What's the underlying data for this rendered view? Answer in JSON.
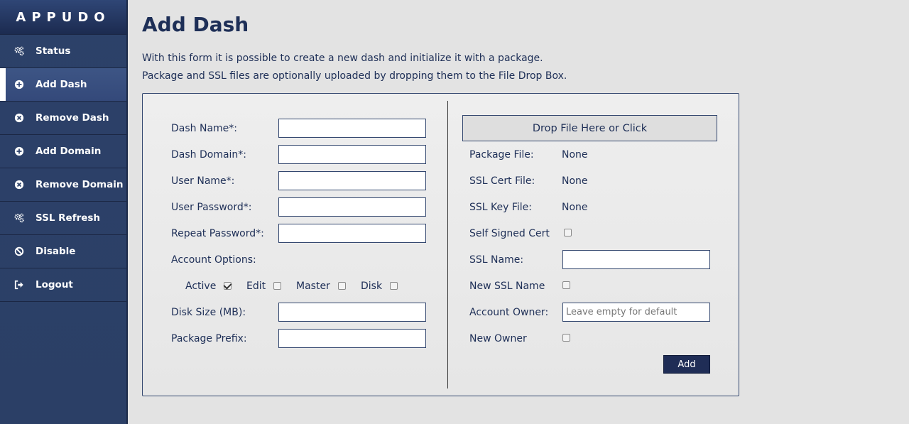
{
  "sidebar": {
    "logo": "APPUDO",
    "items": [
      {
        "label": "Status",
        "icon": "gears-icon"
      },
      {
        "label": "Add Dash",
        "icon": "plus-circle-icon"
      },
      {
        "label": "Remove Dash",
        "icon": "x-circle-icon"
      },
      {
        "label": "Add Domain",
        "icon": "plus-circle-icon"
      },
      {
        "label": "Remove Domain",
        "icon": "x-circle-icon"
      },
      {
        "label": "SSL Refresh",
        "icon": "gears-icon"
      },
      {
        "label": "Disable",
        "icon": "ban-icon"
      },
      {
        "label": "Logout",
        "icon": "sign-out-icon"
      }
    ],
    "active": "Add Dash"
  },
  "page": {
    "title": "Add Dash",
    "intro_line1": "With this form it is possible to create a new dash and initialize it with a package.",
    "intro_line2": "Package and SSL files are optionally uploaded by dropping them to the File Drop Box."
  },
  "form_left": {
    "dash_name_label": "Dash Name*:",
    "dash_domain_label": "Dash Domain*:",
    "user_name_label": "User Name*:",
    "user_password_label": "User Password*:",
    "repeat_password_label": "Repeat Password*:",
    "account_options_label": "Account Options:",
    "options": {
      "active_label": "Active",
      "active_checked": true,
      "edit_label": "Edit",
      "edit_checked": false,
      "master_label": "Master",
      "master_checked": false,
      "disk_label": "Disk",
      "disk_checked": false
    },
    "disk_size_label": "Disk Size (MB):",
    "package_prefix_label": "Package Prefix:"
  },
  "form_right": {
    "drop_box_label": "Drop File Here or Click",
    "package_file_label": "Package File:",
    "package_file_value": "None",
    "ssl_cert_file_label": "SSL Cert File:",
    "ssl_cert_file_value": "None",
    "ssl_key_file_label": "SSL Key File:",
    "ssl_key_file_value": "None",
    "self_signed_label": "Self Signed Cert",
    "ssl_name_label": "SSL Name:",
    "new_ssl_name_label": "New SSL Name",
    "account_owner_label": "Account Owner:",
    "account_owner_placeholder": "Leave empty for default",
    "new_owner_label": "New Owner",
    "add_button": "Add"
  },
  "colors": {
    "sidebar": "#2c4169",
    "accent": "#1e2f57",
    "background": "#e3e3e3"
  }
}
